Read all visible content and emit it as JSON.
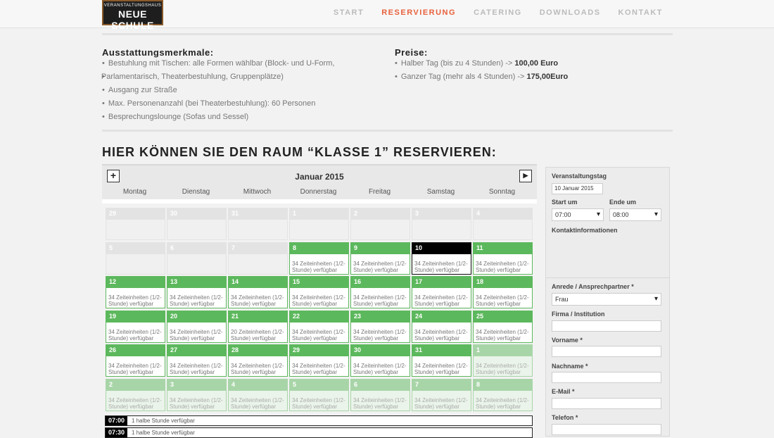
{
  "header": {
    "logo_line1": "VERANSTALTUNGSHAUS",
    "logo_line2": "NEUE SCHULE",
    "nav": [
      "START",
      "RESERVIERUNG",
      "CATERING",
      "DOWNLOADS",
      "KONTAKT"
    ],
    "active_nav": "RESERVIERUNG"
  },
  "features": {
    "title": "Ausstattungsmerkmale:",
    "items": [
      "Bestuhlung mit Tischen: alle Formen wählbar (Block- und U-Form,",
      "Ausgang zur Straße",
      "Max. Personenanzahl (bei Theaterbestuhlung): 60 Personen",
      "Besprechungslounge (Sofas und Sessel)"
    ],
    "item1_cont": "Parlamentarisch, Theaterbestuhlung, Gruppenplätze)"
  },
  "prices": {
    "title": "Preise:",
    "half_label": "Halber Tag (bis zu 4 Stunden) -> ",
    "half_value": "100,00 Euro",
    "full_label": "Ganzer Tag (mehr als 4 Stunden) -> ",
    "full_value": "175,00Euro"
  },
  "reserve_title": "HIER KÖNNEN SIE DEN RAUM “KLASSE 1” RESERVIEREN:",
  "calendar": {
    "month": "Januar 2015",
    "weekdays": [
      "Montag",
      "Dienstag",
      "Mittwoch",
      "Donnerstag",
      "Freitag",
      "Samstag",
      "Sonntag"
    ],
    "slot_text": "34 Zeiteinheiten (1/2-Stunde) verfügbar",
    "weeks": [
      [
        {
          "d": "29",
          "s": "past"
        },
        {
          "d": "30",
          "s": "past"
        },
        {
          "d": "31",
          "s": "past"
        },
        {
          "d": "1",
          "s": "past"
        },
        {
          "d": "2",
          "s": "past"
        },
        {
          "d": "3",
          "s": "past"
        },
        {
          "d": "4",
          "s": "past"
        }
      ],
      [
        {
          "d": "5",
          "s": "past"
        },
        {
          "d": "6",
          "s": "past"
        },
        {
          "d": "7",
          "s": "past"
        },
        {
          "d": "8",
          "s": "avail"
        },
        {
          "d": "9",
          "s": "avail"
        },
        {
          "d": "10",
          "s": "sel"
        },
        {
          "d": "11",
          "s": "avail"
        }
      ],
      [
        {
          "d": "12",
          "s": "avail"
        },
        {
          "d": "13",
          "s": "avail"
        },
        {
          "d": "14",
          "s": "avail"
        },
        {
          "d": "15",
          "s": "avail"
        },
        {
          "d": "16",
          "s": "avail"
        },
        {
          "d": "17",
          "s": "avail"
        },
        {
          "d": "18",
          "s": "avail"
        }
      ],
      [
        {
          "d": "19",
          "s": "avail"
        },
        {
          "d": "20",
          "s": "avail"
        },
        {
          "d": "21",
          "s": "avail",
          "t": "20 Zeiteinheiten (1/2-Stunde) verfügbar"
        },
        {
          "d": "22",
          "s": "avail"
        },
        {
          "d": "23",
          "s": "avail"
        },
        {
          "d": "24",
          "s": "avail"
        },
        {
          "d": "25",
          "s": "avail"
        }
      ],
      [
        {
          "d": "26",
          "s": "avail"
        },
        {
          "d": "27",
          "s": "avail"
        },
        {
          "d": "28",
          "s": "avail"
        },
        {
          "d": "29",
          "s": "avail"
        },
        {
          "d": "30",
          "s": "avail"
        },
        {
          "d": "31",
          "s": "avail"
        },
        {
          "d": "1",
          "s": "next"
        }
      ],
      [
        {
          "d": "2",
          "s": "next"
        },
        {
          "d": "3",
          "s": "next"
        },
        {
          "d": "4",
          "s": "next"
        },
        {
          "d": "5",
          "s": "next"
        },
        {
          "d": "6",
          "s": "next"
        },
        {
          "d": "7",
          "s": "next"
        },
        {
          "d": "8",
          "s": "next"
        }
      ]
    ],
    "slots": [
      {
        "time": "07:00",
        "text": "1 halbe Stunde verfügbar"
      },
      {
        "time": "07:30",
        "text": "1 halbe Stunde verfügbar"
      }
    ]
  },
  "form": {
    "event_day_label": "Veranstaltungstag",
    "event_day_value": "10 Januar 2015",
    "start_label": "Start um",
    "start_value": "07:00",
    "end_label": "Ende um",
    "end_value": "08:00",
    "contact_label": "Kontaktinformationen",
    "salutation_label": "Anrede / Ansprechpartner *",
    "salutation_value": "Frau",
    "company_label": "Firma / Institution",
    "firstname_label": "Vorname *",
    "lastname_label": "Nachname *",
    "email_label": "E-Mail *",
    "phone_label": "Telefon *"
  },
  "colors": {
    "accent": "#e8603c",
    "available": "#5cb85c",
    "selected": "#000000"
  }
}
